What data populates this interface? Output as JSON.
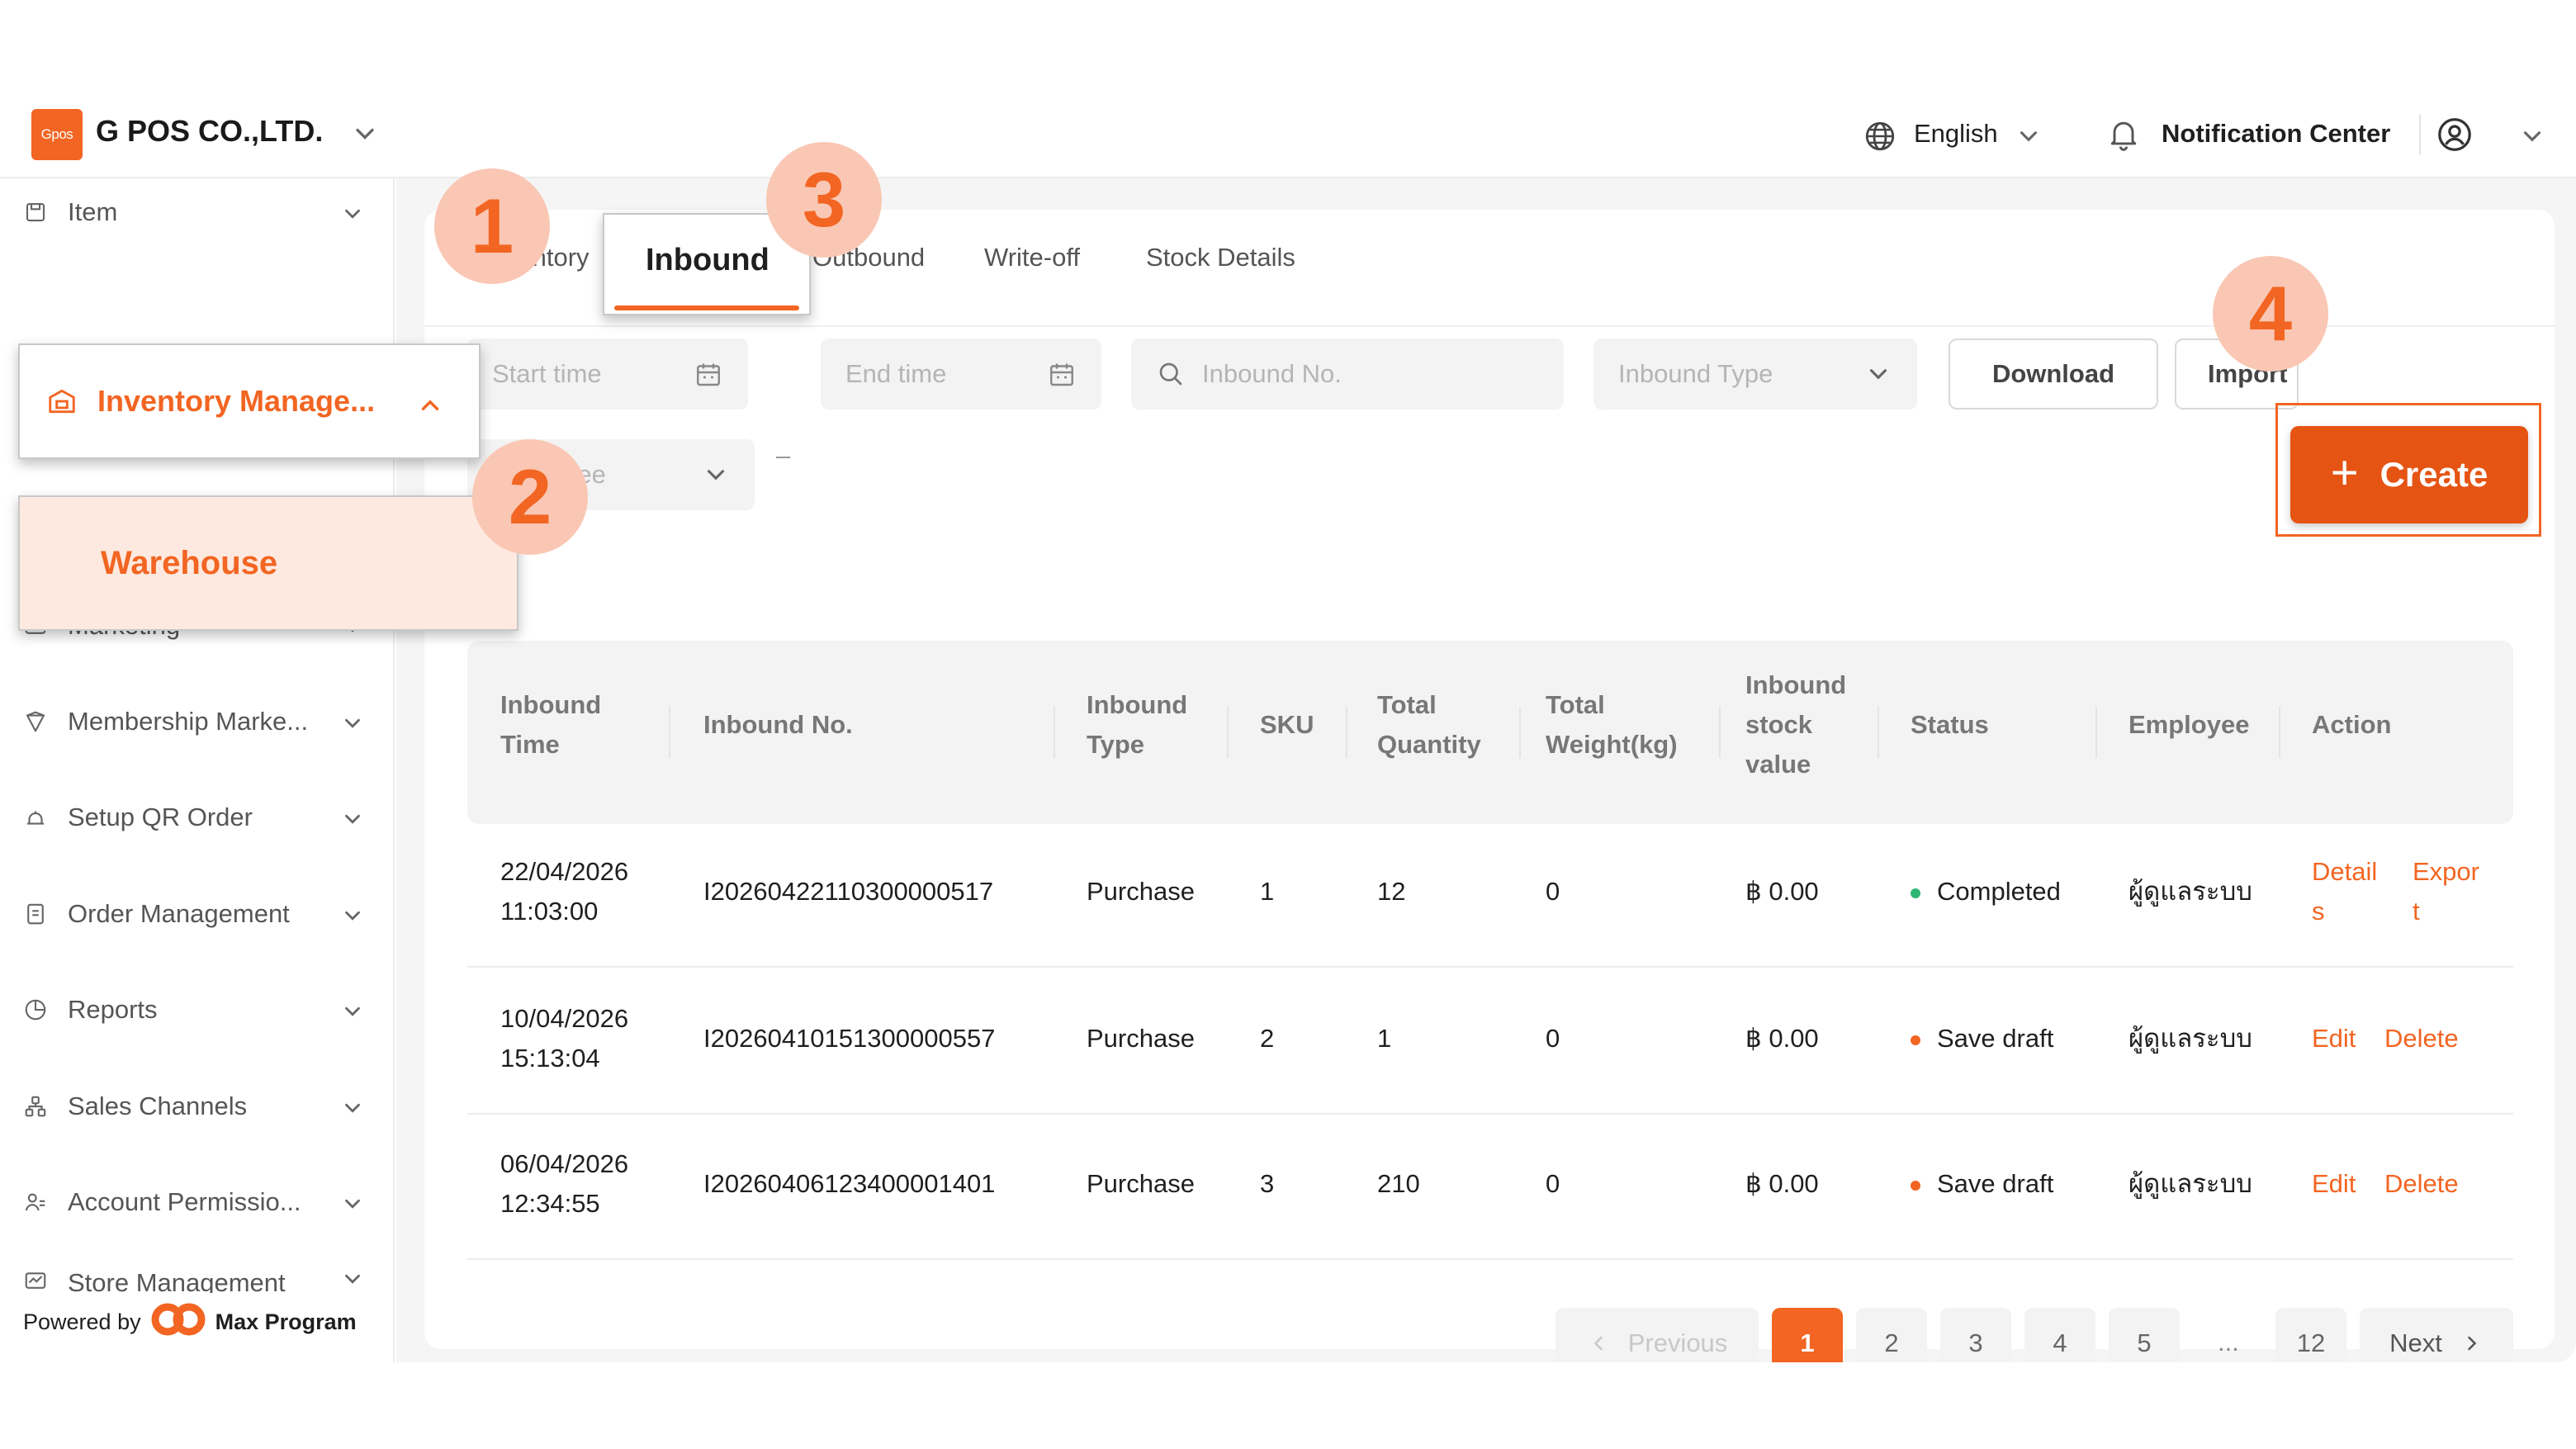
{
  "header": {
    "logo_text": "Gpos",
    "company": "G POS CO.,LTD.",
    "language": "English",
    "notification_label": "Notification Center",
    "accent_color": "#f26522"
  },
  "sidebar": {
    "items": [
      {
        "label": "Item",
        "icon": "item-icon"
      },
      {
        "label": "Marketing",
        "icon": "marketing-icon"
      },
      {
        "label": "Membership Marke...",
        "icon": "membership-icon"
      },
      {
        "label": "Setup QR Order",
        "icon": "qr-order-icon"
      },
      {
        "label": "Order Management",
        "icon": "order-icon"
      },
      {
        "label": "Reports",
        "icon": "reports-icon"
      },
      {
        "label": "Sales Channels",
        "icon": "sales-channels-icon"
      },
      {
        "label": "Account Permissio...",
        "icon": "account-icon"
      },
      {
        "label": "Store Management",
        "icon": "store-icon"
      }
    ],
    "inventory_label": "Inventory Manage...",
    "warehouse_label": "Warehouse",
    "powered_by": "Powered by",
    "powered_brand": "Max Program"
  },
  "badges": {
    "one": "1",
    "two": "2",
    "three": "3",
    "four": "4"
  },
  "tabs": {
    "inventory": "Inventory",
    "inbound": "Inbound",
    "outbound": "Outbound",
    "writeoff": "Write-off",
    "stock_details": "Stock Details"
  },
  "filters": {
    "start_time": "Start time",
    "end_time": "End time",
    "inbound_no": "Inbound No.",
    "inbound_type": "Inbound Type",
    "employee": "Employee",
    "download": "Download",
    "import": "Import",
    "create": "Create"
  },
  "table": {
    "headers": {
      "inbound_time": [
        "Inbound",
        "Time"
      ],
      "inbound_no": "Inbound No.",
      "inbound_type": [
        "Inbound",
        "Type"
      ],
      "sku": "SKU",
      "total_quantity": [
        "Total",
        "Quantity"
      ],
      "total_weight": [
        "Total",
        "Weight(kg)"
      ],
      "stock_value": [
        "Inbound",
        "stock",
        "value"
      ],
      "status": "Status",
      "employee": "Employee",
      "action": "Action"
    },
    "rows": [
      {
        "date": "22/04/2026",
        "time": "11:03:00",
        "no": "I20260422110300000517",
        "type": "Purchase",
        "sku": "1",
        "qty": "12",
        "weight": "0",
        "value": "฿ 0.00",
        "status": "Completed",
        "status_color": "#2bb673",
        "employee": "ผู้ดูแลระบบ",
        "action1a": "Detail",
        "action1b": "s",
        "action2a": "Expor",
        "action2b": "t"
      },
      {
        "date": "10/04/2026",
        "time": "15:13:04",
        "no": "I20260410151300000557",
        "type": "Purchase",
        "sku": "2",
        "qty": "1",
        "weight": "0",
        "value": "฿ 0.00",
        "status": "Save draft",
        "status_color": "#f26522",
        "employee": "ผู้ดูแลระบบ",
        "action1": "Edit",
        "action2": "Delete"
      },
      {
        "date": "06/04/2026",
        "time": "12:34:55",
        "no": "I20260406123400001401",
        "type": "Purchase",
        "sku": "3",
        "qty": "210",
        "weight": "0",
        "value": "฿ 0.00",
        "status": "Save draft",
        "status_color": "#f26522",
        "employee": "ผู้ดูแลระบบ",
        "action1": "Edit",
        "action2": "Delete"
      }
    ]
  },
  "pagination": {
    "previous": "Previous",
    "pages": [
      "1",
      "2",
      "3",
      "4",
      "5"
    ],
    "ellipsis": "...",
    "last": "12",
    "next": "Next",
    "current": "1"
  }
}
